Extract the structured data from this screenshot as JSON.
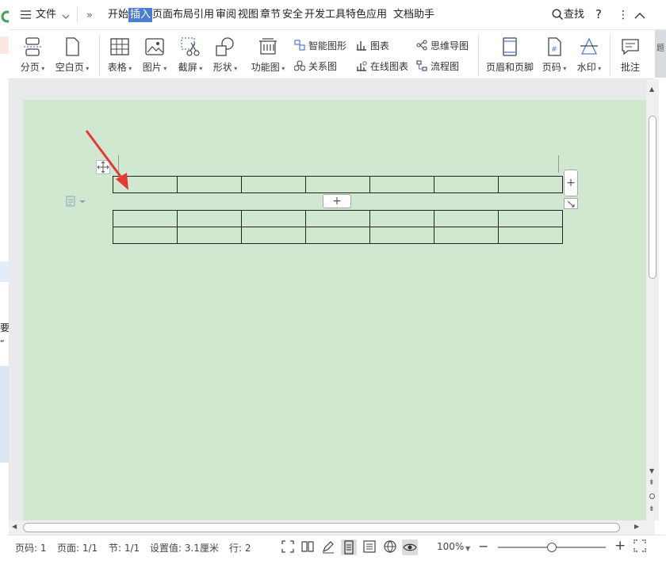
{
  "menubar": {
    "file_label": "文件",
    "tabs": [
      "开始",
      "插入",
      "页面布局",
      "引用",
      "审阅",
      "视图",
      "章节",
      "安全",
      "开发工具",
      "特色应用"
    ],
    "assistant": "文档助手",
    "search_label": "查找",
    "help": "?",
    "more": "⋮"
  },
  "ribbon": {
    "page_break": "分页",
    "blank_page": "空白页",
    "table": "表格",
    "picture": "图片",
    "screenshot": "截屏",
    "shapes": "形状",
    "function_chart": "功能图",
    "smart_art": "智能图形",
    "chart": "图表",
    "mind_map": "思维导图",
    "relation_chart": "关系图",
    "online_chart": "在线图表",
    "flowchart": "流程图",
    "header_footer": "页眉和页脚",
    "page_number": "页码",
    "watermark": "水印",
    "comment": "批注",
    "right_cut": "题"
  },
  "document": {
    "table_a": {
      "rows": 1,
      "cols": 7
    },
    "table_b": {
      "rows": 2,
      "cols": 7
    },
    "add_row_glyph": "+",
    "add_col_glyph": "+"
  },
  "statusbar": {
    "page_num": "页码: 1",
    "pages": "页面: 1/1",
    "section": "节: 1/1",
    "position": "设置值: 3.1厘米",
    "line": "行: 2",
    "zoom": "100%",
    "zoom_minus": "−",
    "zoom_plus": "+",
    "zoom_level": 0.5
  },
  "colors": {
    "page_bg": "#cfe8cf",
    "accent": "#4d7cd6",
    "arrow": "#e53935"
  },
  "left_strip": {
    "chars": [
      "要",
      "“"
    ]
  }
}
